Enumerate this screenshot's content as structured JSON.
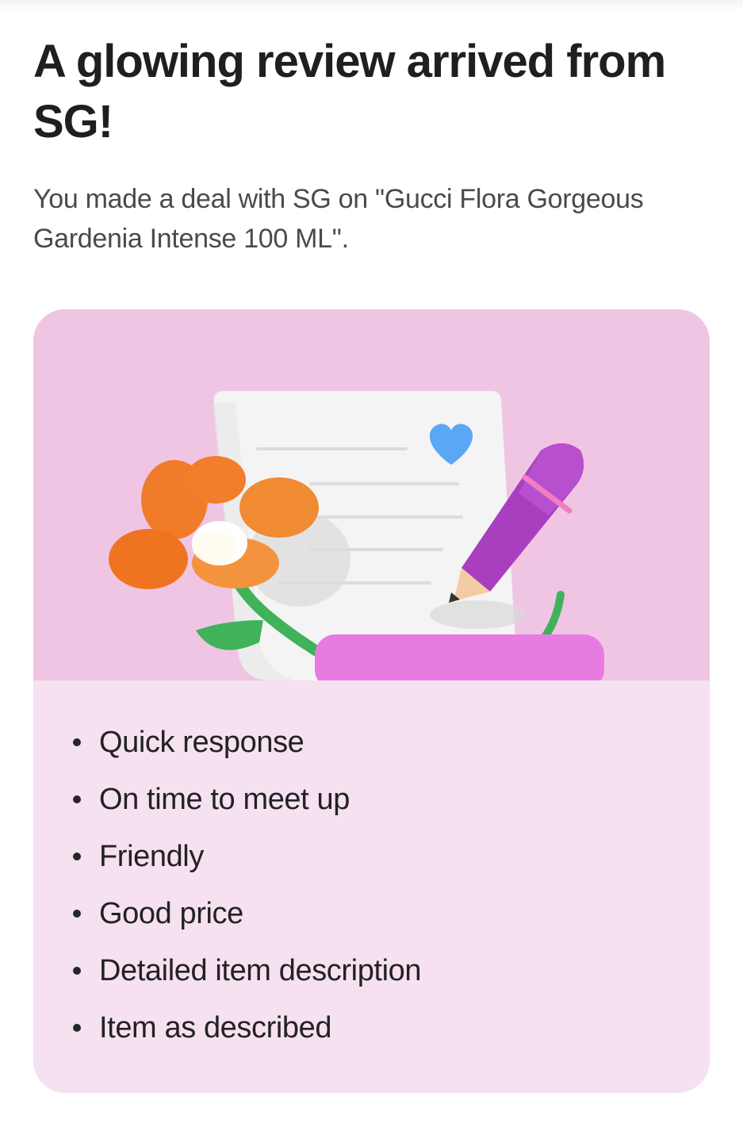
{
  "header": {
    "title": "A glowing review arrived from SG!",
    "subtitle": "You made a deal with SG on \"Gucci Flora Gorgeous Gardenia Intense 100 ML\"."
  },
  "card": {
    "illustration": {
      "icons": [
        "review-document-icon",
        "heart-icon",
        "pencil-icon",
        "flower-icon"
      ],
      "colors": {
        "background": "#f0c5e4",
        "paper": "#f4f4f4",
        "heart": "#5aa7f5",
        "pencil": "#a93ebf",
        "flower": "#f07c2a",
        "stem": "#3fb25a",
        "base": "#e77be0"
      }
    },
    "traits": [
      "Quick response",
      "On time to meet up",
      "Friendly",
      "Good price",
      "Detailed item description",
      "Item as described"
    ]
  },
  "colors": {
    "card_background": "#f6e1f0",
    "title_text": "#1f1f1f",
    "subtitle_text": "#4a4a4a"
  }
}
